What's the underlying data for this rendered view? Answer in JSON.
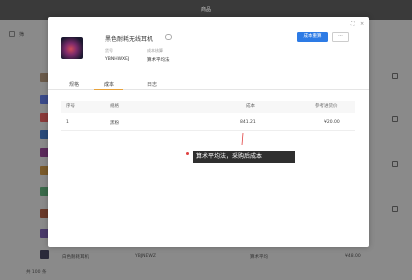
{
  "header": {
    "title": "商品"
  },
  "toolbar": {
    "label": "筛"
  },
  "product": {
    "name": "黑色耐耗无线耳机",
    "sku_label": "货号",
    "sku_value": "YBNHWXEJ",
    "cost_method_label": "成本核算",
    "cost_method_value": "算术平均法"
  },
  "actions": {
    "primary_label": "成本重算",
    "more_label": "···"
  },
  "tabs": [
    {
      "label": "规格"
    },
    {
      "label": "成本"
    },
    {
      "label": "日志"
    }
  ],
  "table": {
    "headers": [
      "序号",
      "规格",
      "成本",
      "参考进货价"
    ],
    "rows": [
      {
        "index": "1",
        "spec": "黑粉",
        "cost": "841.21",
        "ref_price": "¥20.00"
      }
    ]
  },
  "annotation": {
    "text": "算术平均法，采购后成本"
  },
  "background": {
    "row_texts": [
      "白色耐耗耳机",
      "YBJNEWZ",
      "算术平均",
      "¥48.00"
    ],
    "footer": "共 100 条"
  },
  "colors": {
    "accent": "#2d7be5",
    "tab_active": "#e8a23a",
    "annotation_bg": "#2f2f2f"
  }
}
